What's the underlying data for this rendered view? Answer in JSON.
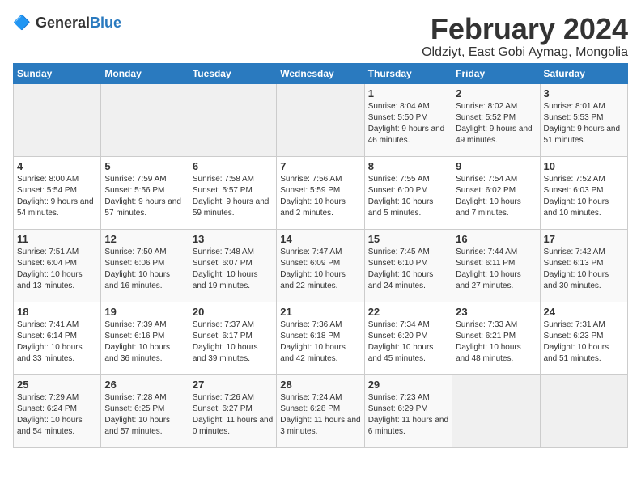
{
  "logo": {
    "general": "General",
    "blue": "Blue"
  },
  "header": {
    "month": "February 2024",
    "location": "Oldziyt, East Gobi Aymag, Mongolia"
  },
  "days_of_week": [
    "Sunday",
    "Monday",
    "Tuesday",
    "Wednesday",
    "Thursday",
    "Friday",
    "Saturday"
  ],
  "weeks": [
    [
      {
        "day": "",
        "content": ""
      },
      {
        "day": "",
        "content": ""
      },
      {
        "day": "",
        "content": ""
      },
      {
        "day": "",
        "content": ""
      },
      {
        "day": "1",
        "content": "Sunrise: 8:04 AM\nSunset: 5:50 PM\nDaylight: 9 hours and 46 minutes."
      },
      {
        "day": "2",
        "content": "Sunrise: 8:02 AM\nSunset: 5:52 PM\nDaylight: 9 hours and 49 minutes."
      },
      {
        "day": "3",
        "content": "Sunrise: 8:01 AM\nSunset: 5:53 PM\nDaylight: 9 hours and 51 minutes."
      }
    ],
    [
      {
        "day": "4",
        "content": "Sunrise: 8:00 AM\nSunset: 5:54 PM\nDaylight: 9 hours and 54 minutes."
      },
      {
        "day": "5",
        "content": "Sunrise: 7:59 AM\nSunset: 5:56 PM\nDaylight: 9 hours and 57 minutes."
      },
      {
        "day": "6",
        "content": "Sunrise: 7:58 AM\nSunset: 5:57 PM\nDaylight: 9 hours and 59 minutes."
      },
      {
        "day": "7",
        "content": "Sunrise: 7:56 AM\nSunset: 5:59 PM\nDaylight: 10 hours and 2 minutes."
      },
      {
        "day": "8",
        "content": "Sunrise: 7:55 AM\nSunset: 6:00 PM\nDaylight: 10 hours and 5 minutes."
      },
      {
        "day": "9",
        "content": "Sunrise: 7:54 AM\nSunset: 6:02 PM\nDaylight: 10 hours and 7 minutes."
      },
      {
        "day": "10",
        "content": "Sunrise: 7:52 AM\nSunset: 6:03 PM\nDaylight: 10 hours and 10 minutes."
      }
    ],
    [
      {
        "day": "11",
        "content": "Sunrise: 7:51 AM\nSunset: 6:04 PM\nDaylight: 10 hours and 13 minutes."
      },
      {
        "day": "12",
        "content": "Sunrise: 7:50 AM\nSunset: 6:06 PM\nDaylight: 10 hours and 16 minutes."
      },
      {
        "day": "13",
        "content": "Sunrise: 7:48 AM\nSunset: 6:07 PM\nDaylight: 10 hours and 19 minutes."
      },
      {
        "day": "14",
        "content": "Sunrise: 7:47 AM\nSunset: 6:09 PM\nDaylight: 10 hours and 22 minutes."
      },
      {
        "day": "15",
        "content": "Sunrise: 7:45 AM\nSunset: 6:10 PM\nDaylight: 10 hours and 24 minutes."
      },
      {
        "day": "16",
        "content": "Sunrise: 7:44 AM\nSunset: 6:11 PM\nDaylight: 10 hours and 27 minutes."
      },
      {
        "day": "17",
        "content": "Sunrise: 7:42 AM\nSunset: 6:13 PM\nDaylight: 10 hours and 30 minutes."
      }
    ],
    [
      {
        "day": "18",
        "content": "Sunrise: 7:41 AM\nSunset: 6:14 PM\nDaylight: 10 hours and 33 minutes."
      },
      {
        "day": "19",
        "content": "Sunrise: 7:39 AM\nSunset: 6:16 PM\nDaylight: 10 hours and 36 minutes."
      },
      {
        "day": "20",
        "content": "Sunrise: 7:37 AM\nSunset: 6:17 PM\nDaylight: 10 hours and 39 minutes."
      },
      {
        "day": "21",
        "content": "Sunrise: 7:36 AM\nSunset: 6:18 PM\nDaylight: 10 hours and 42 minutes."
      },
      {
        "day": "22",
        "content": "Sunrise: 7:34 AM\nSunset: 6:20 PM\nDaylight: 10 hours and 45 minutes."
      },
      {
        "day": "23",
        "content": "Sunrise: 7:33 AM\nSunset: 6:21 PM\nDaylight: 10 hours and 48 minutes."
      },
      {
        "day": "24",
        "content": "Sunrise: 7:31 AM\nSunset: 6:23 PM\nDaylight: 10 hours and 51 minutes."
      }
    ],
    [
      {
        "day": "25",
        "content": "Sunrise: 7:29 AM\nSunset: 6:24 PM\nDaylight: 10 hours and 54 minutes."
      },
      {
        "day": "26",
        "content": "Sunrise: 7:28 AM\nSunset: 6:25 PM\nDaylight: 10 hours and 57 minutes."
      },
      {
        "day": "27",
        "content": "Sunrise: 7:26 AM\nSunset: 6:27 PM\nDaylight: 11 hours and 0 minutes."
      },
      {
        "day": "28",
        "content": "Sunrise: 7:24 AM\nSunset: 6:28 PM\nDaylight: 11 hours and 3 minutes."
      },
      {
        "day": "29",
        "content": "Sunrise: 7:23 AM\nSunset: 6:29 PM\nDaylight: 11 hours and 6 minutes."
      },
      {
        "day": "",
        "content": ""
      },
      {
        "day": "",
        "content": ""
      }
    ]
  ]
}
